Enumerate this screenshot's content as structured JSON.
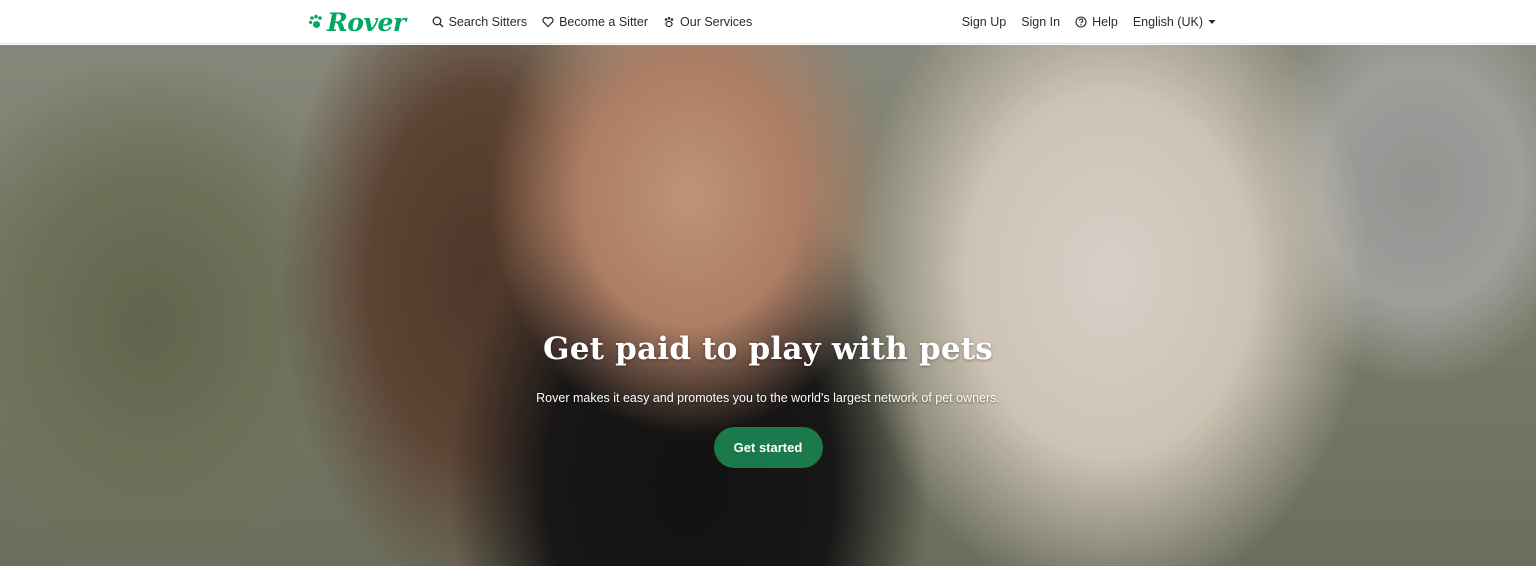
{
  "nav": {
    "logo_text": "Rover",
    "links": [
      {
        "label": "Search Sitters",
        "icon": "search-icon"
      },
      {
        "label": "Become a Sitter",
        "icon": "heart-icon"
      },
      {
        "label": "Our Services",
        "icon": "paw-icon"
      }
    ],
    "right": {
      "sign_up": "Sign Up",
      "sign_in": "Sign In",
      "help": "Help",
      "language": "English (UK)"
    }
  },
  "hero": {
    "title": "Get paid to play with pets",
    "subtitle": "Rover makes it easy and promotes you to the world's largest network of pet owners.",
    "cta_label": "Get started"
  },
  "colors": {
    "brand_green": "#00a862",
    "cta_green": "#1b7a4c"
  }
}
